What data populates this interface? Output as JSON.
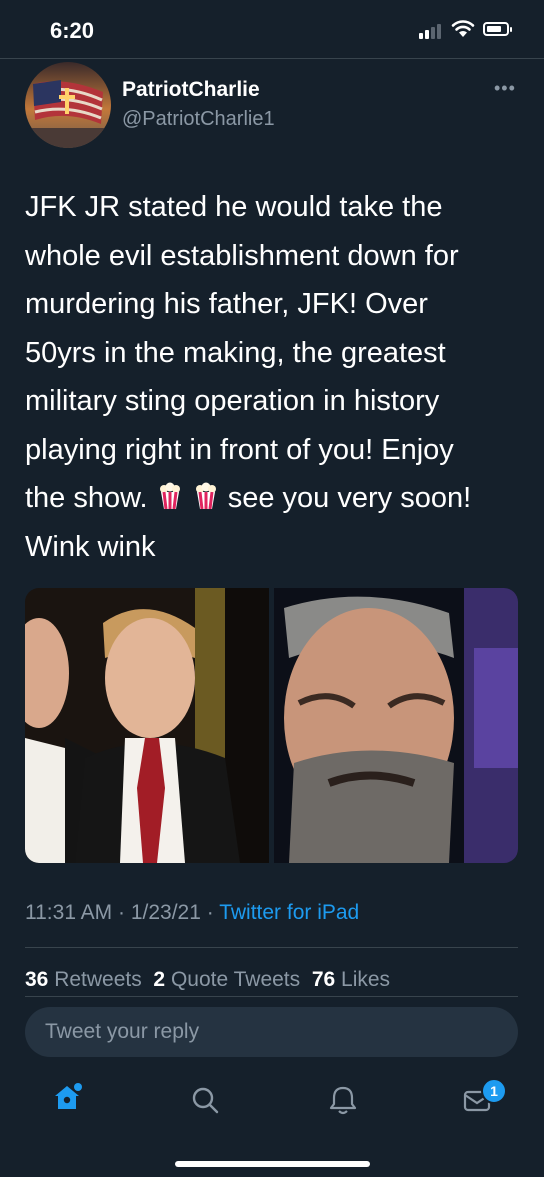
{
  "status_bar": {
    "time": "6:20",
    "icons": [
      "signal-icon",
      "wifi-icon",
      "battery-icon"
    ]
  },
  "tweet": {
    "author": {
      "display_name": "PatriotCharlie",
      "handle": "@PatriotCharlie1"
    },
    "text_lines": [
      "JFK JR stated he would take the",
      "whole evil establishment down for",
      "murdering his father, JFK!  Over",
      "50yrs in the making, the greatest",
      "military sting operation in history",
      "playing right in front of you!  Enjoy"
    ],
    "text_show_a": "the show.",
    "text_show_b": "see you very soon!",
    "text_last": "Wink wink",
    "emoji": "popcorn-icon",
    "timestamp": "11:31 AM · 1/23/21 · ",
    "source": "Twitter for iPad",
    "stats": {
      "retweets_count": "36",
      "retweets_label": "Retweets",
      "quotes_count": "2",
      "quotes_label": "Quote Tweets",
      "likes_count": "76",
      "likes_label": "Likes"
    }
  },
  "reply": {
    "placeholder": "Tweet your reply"
  },
  "tabbar": {
    "items": [
      "home-icon",
      "search-icon",
      "notifications-icon",
      "messages-icon"
    ],
    "messages_badge": "1"
  },
  "colors": {
    "background": "#15202b",
    "accent": "#1d9bf0",
    "secondary_text": "#8b98a5",
    "divider": "#38444d"
  }
}
